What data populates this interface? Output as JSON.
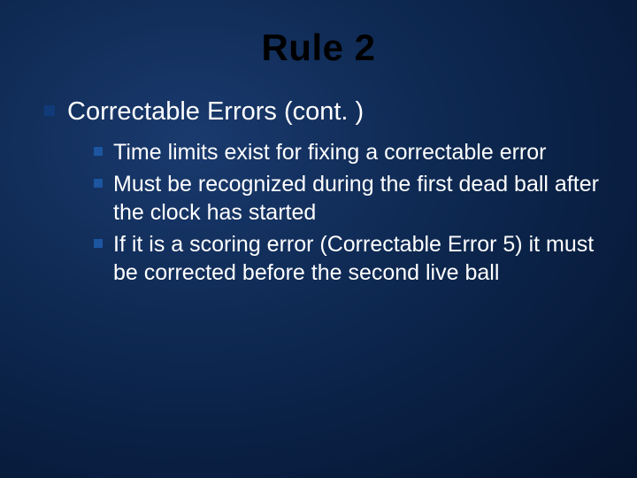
{
  "slide": {
    "title": "Rule 2",
    "level1": {
      "text": "Correctable Errors (cont. )"
    },
    "level2": [
      {
        "text": "Time limits exist for fixing a correctable error"
      },
      {
        "text": "Must be recognized during the first dead ball after the clock has started"
      },
      {
        "text": "If it is a scoring error (Correctable Error 5) it must be corrected before the second live ball"
      }
    ]
  }
}
